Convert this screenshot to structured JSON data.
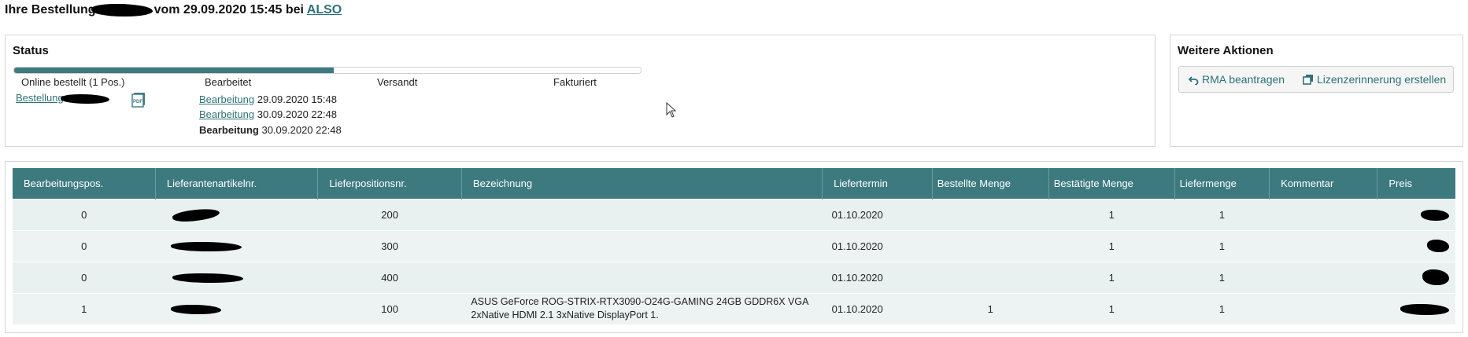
{
  "page": {
    "title_prefix": "Ihre Bestellung",
    "title_middle": "vom 29.09.2020 15:45 bei",
    "supplier_link": "ALSO"
  },
  "status": {
    "heading": "Status",
    "progress_percent": 51,
    "steps": [
      "Online bestellt (1 Pos.)",
      "Bearbeitet",
      "Versandt",
      "Fakturiert"
    ],
    "order_link": "Bestellung",
    "pdf_icon": "pdf-icon",
    "events": [
      {
        "label": "Bearbeitung",
        "time": "29.09.2020 15:48"
      },
      {
        "label": "Bearbeitung",
        "time": "30.09.2020 22:48"
      },
      {
        "label": "Bearbeitung",
        "time": "30.09.2020 22:48"
      }
    ]
  },
  "actions": {
    "heading": "Weitere Aktionen",
    "rma_label": "RMA beantragen",
    "rma_icon": "undo-icon",
    "license_label": "Lizenzerinnerung erstellen",
    "license_icon": "copy-icon"
  },
  "table": {
    "headers": [
      "Bearbeitungspos.",
      "Lieferantenartikelnr.",
      "Lieferpositionsnr.",
      "Bezeichnung",
      "Liefertermin",
      "Bestellte Menge",
      "Bestätigte Menge",
      "Liefermenge",
      "Kommentar",
      "Preis"
    ],
    "rows": [
      {
        "pos": "0",
        "lieferpos": "200",
        "bezeichnung": "",
        "termin": "01.10.2020",
        "bestellt": "",
        "bestaetigt": "1",
        "liefermenge": "1",
        "kommentar": ""
      },
      {
        "pos": "0",
        "lieferpos": "300",
        "bezeichnung": "",
        "termin": "01.10.2020",
        "bestellt": "",
        "bestaetigt": "1",
        "liefermenge": "1",
        "kommentar": ""
      },
      {
        "pos": "0",
        "lieferpos": "400",
        "bezeichnung": "",
        "termin": "01.10.2020",
        "bestellt": "",
        "bestaetigt": "1",
        "liefermenge": "1",
        "kommentar": ""
      },
      {
        "pos": "1",
        "lieferpos": "100",
        "bezeichnung": "ASUS GeForce ROG-STRIX-RTX3090-O24G-GAMING 24GB GDDR6X VGA 2xNative HDMI 2.1 3xNative DisplayPort 1.",
        "termin": "01.10.2020",
        "bestellt": "1",
        "bestaetigt": "1",
        "liefermenge": "1",
        "kommentar": ""
      }
    ]
  },
  "colors": {
    "accent": "#3d7a80",
    "link": "#2e7178",
    "row_bg": "#e8f0f0"
  }
}
